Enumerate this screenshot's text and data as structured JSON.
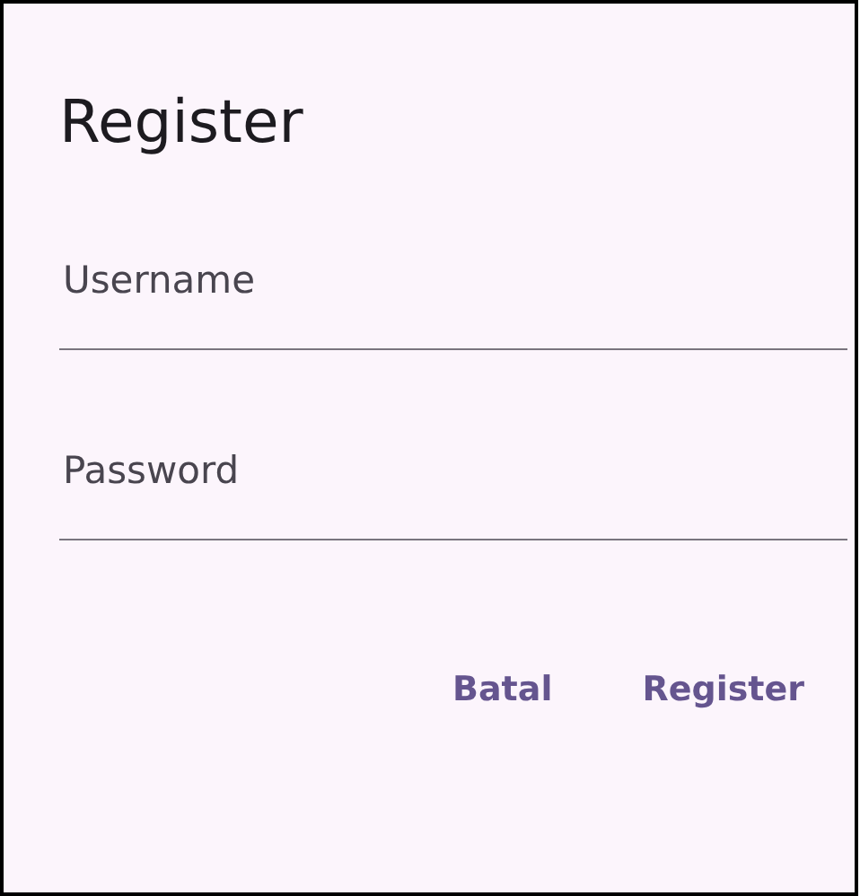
{
  "dialog": {
    "title": "Register",
    "fields": [
      {
        "placeholder": "Username"
      },
      {
        "placeholder": "Password"
      }
    ],
    "buttons": [
      "Batal",
      "Register"
    ]
  }
}
